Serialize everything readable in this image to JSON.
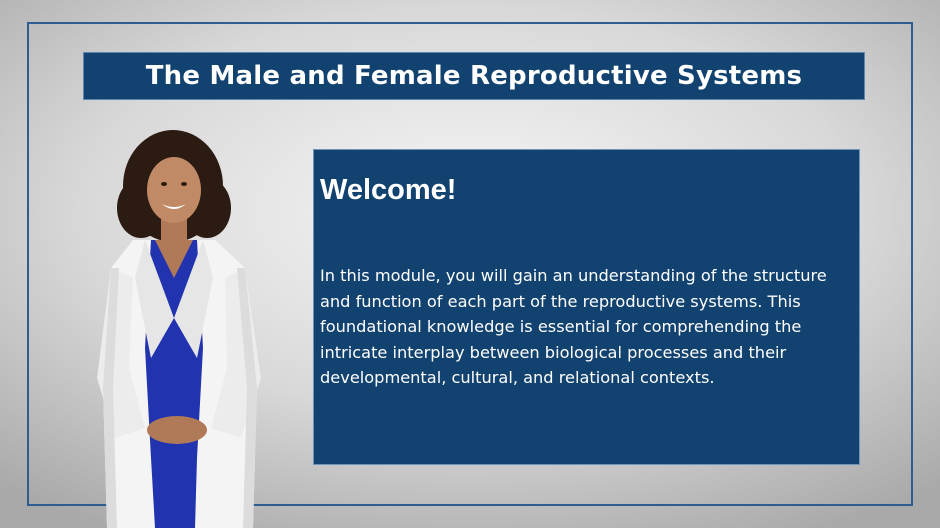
{
  "slide": {
    "title": "The Male and Female Reproductive Systems",
    "welcome": {
      "heading": "Welcome!",
      "body": "In this module, you will gain an understanding of the structure and function of each part of the reproductive systems. This foundational knowledge is essential for comprehending the intricate interplay between biological processes and their developmental, cultural, and relational contexts."
    }
  },
  "colors": {
    "title_background": "#12426f",
    "content_background": "#12426f",
    "frame_border": "#2e5d93",
    "text": "#ffffff"
  }
}
